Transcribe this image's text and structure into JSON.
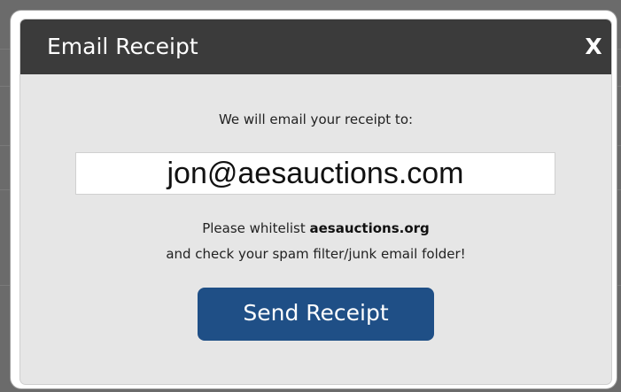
{
  "dialog": {
    "title": "Email Receipt",
    "close_label": "X",
    "intro": "We will email your receipt to:",
    "email_value": "jon@aesauctions.com",
    "whitelist_prefix": "Please whitelist ",
    "whitelist_domain": "aesauctions.org",
    "spam_note": "and check your spam filter/junk email folder!",
    "send_label": "Send Receipt"
  },
  "colors": {
    "title_bar": "#3b3b3b",
    "dialog_body": "#e6e6e6",
    "send_button": "#1f4f86",
    "backdrop": "#6b6b6b"
  }
}
